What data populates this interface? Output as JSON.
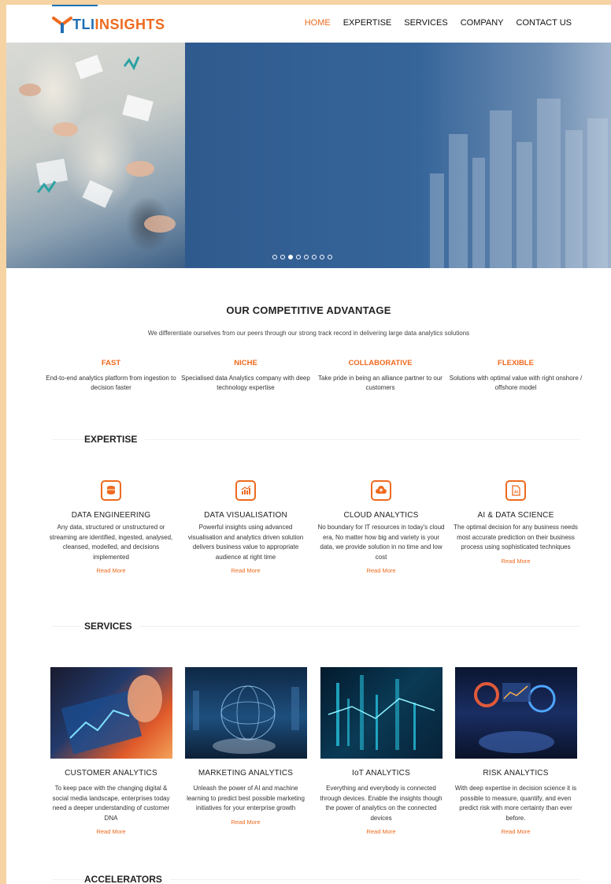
{
  "header": {
    "logo": {
      "tli": "TLI",
      "insights": "INSIGHTS"
    },
    "nav": [
      {
        "label": "HOME",
        "active": true
      },
      {
        "label": "EXPERTISE",
        "active": false
      },
      {
        "label": "SERVICES",
        "active": false
      },
      {
        "label": "COMPANY",
        "active": false
      },
      {
        "label": "CONTACT US",
        "active": false
      }
    ]
  },
  "hero": {
    "slide_count": 8,
    "active_slide": 3
  },
  "advantage": {
    "title": "OUR COMPETITIVE ADVANTAGE",
    "subtitle": "We differentiate ourselves from our peers through our strong track record in delivering large data analytics solutions",
    "items": [
      {
        "title": "FAST",
        "desc": "End-to-end analytics platform from ingestion to decision faster"
      },
      {
        "title": "NICHE",
        "desc": "Specialised data Analytics company with deep technology expertise"
      },
      {
        "title": "COLLABORATIVE",
        "desc": "Take pride in being an alliance partner to our customers"
      },
      {
        "title": "FLEXIBLE",
        "desc": "Solutions with optimal value with right onshore / offshore model"
      }
    ]
  },
  "expertise": {
    "heading": "EXPERTISE",
    "items": [
      {
        "icon": "database-icon",
        "title": "DATA ENGINEERING",
        "desc": "Any data, structured or unstructured or streaming are identified, ingested, analysed, cleansed, modelled, and decisions implemented",
        "link": "Read More"
      },
      {
        "icon": "chart-icon",
        "title": "DATA VISUALISATION",
        "desc": "Powerful insights using advanced visualisation and analytics driven solution delivers business value to appropriate audience at right time",
        "link": "Read More"
      },
      {
        "icon": "cloud-icon",
        "title": "CLOUD ANALYTICS",
        "desc": "No boundary for IT resources in today's cloud era, No matter how big and variety is your data, we provide solution in no time and low cost",
        "link": "Read More"
      },
      {
        "icon": "ai-document-icon",
        "title": "AI & DATA SCIENCE",
        "desc": "The optimal decision for any business needs most accurate prediction on their business process using sophisticated techniques",
        "link": "Read More"
      }
    ]
  },
  "services": {
    "heading": "SERVICES",
    "items": [
      {
        "title": "CUSTOMER ANALYTICS",
        "desc": "To keep pace with the changing digital & social media landscape, enterprises today need a deeper understanding of customer DNA",
        "link": "Read More"
      },
      {
        "title": "MARKETING ANALYTICS",
        "desc": "Unleash the power of AI and machine learning to predict best possible marketing initiatives for your enterprise growth",
        "link": "Read More"
      },
      {
        "title": "IoT ANALYTICS",
        "desc": "Everything and everybody is connected through devices. Enable the insights though the power of analytics on the connected devices",
        "link": "Read More"
      },
      {
        "title": "RISK ANALYTICS",
        "desc": "With deep expertise in decision science it is possible to measure, quantify, and even predict risk with more certainty than ever before.",
        "link": "Read More"
      }
    ]
  },
  "accelerators": {
    "heading": "ACCELERATORS"
  },
  "colors": {
    "accent": "#ee6a1f",
    "brand_blue": "#1f6fb6",
    "hero_blue": "#2f5b8f",
    "frame": "#f6d3a3"
  }
}
